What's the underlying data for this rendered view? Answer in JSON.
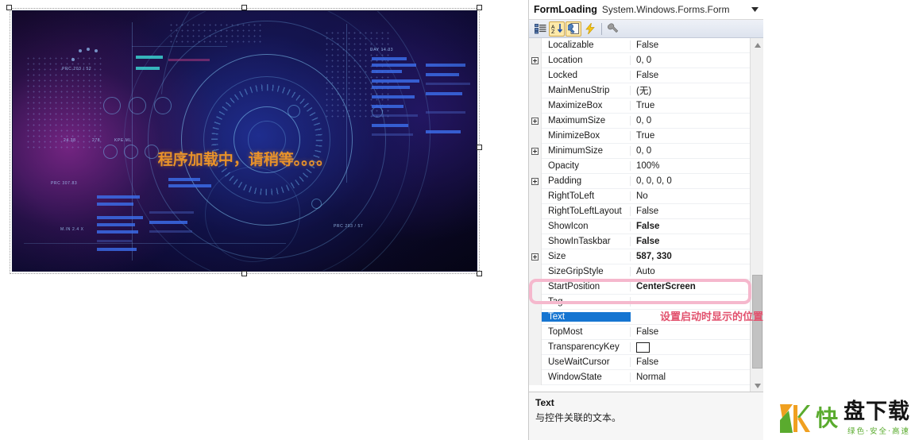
{
  "designer": {
    "form_name": "FormLoading",
    "loading_text": "程序加载中，请稍等。。。。",
    "hud_labels": [
      "PRC 203 / 52",
      "DAY 14.33",
      "24.38",
      "278",
      "KPE.ML",
      "PRC 307.83",
      "PRC 203 / 57",
      "M.IN 2.4 X"
    ]
  },
  "properties_panel": {
    "object_name": "FormLoading",
    "object_type": "System.Windows.Forms.Form",
    "toolbar": {
      "categorized_label": "Categorized",
      "alphabetical_label": "Alphabetical",
      "properties_label": "Properties",
      "events_label": "Events",
      "property_pages_label": "Property Pages"
    },
    "rows": [
      {
        "name": "Localizable",
        "value": "False",
        "expandable": false,
        "bold": false,
        "selected": false
      },
      {
        "name": "Location",
        "value": "0, 0",
        "expandable": true,
        "bold": false,
        "selected": false
      },
      {
        "name": "Locked",
        "value": "False",
        "expandable": false,
        "bold": false,
        "selected": false
      },
      {
        "name": "MainMenuStrip",
        "value": "(无)",
        "expandable": false,
        "bold": false,
        "selected": false
      },
      {
        "name": "MaximizeBox",
        "value": "True",
        "expandable": false,
        "bold": false,
        "selected": false
      },
      {
        "name": "MaximumSize",
        "value": "0, 0",
        "expandable": true,
        "bold": false,
        "selected": false
      },
      {
        "name": "MinimizeBox",
        "value": "True",
        "expandable": false,
        "bold": false,
        "selected": false
      },
      {
        "name": "MinimumSize",
        "value": "0, 0",
        "expandable": true,
        "bold": false,
        "selected": false
      },
      {
        "name": "Opacity",
        "value": "100%",
        "expandable": false,
        "bold": false,
        "selected": false
      },
      {
        "name": "Padding",
        "value": "0, 0, 0, 0",
        "expandable": true,
        "bold": false,
        "selected": false
      },
      {
        "name": "RightToLeft",
        "value": "No",
        "expandable": false,
        "bold": false,
        "selected": false
      },
      {
        "name": "RightToLeftLayout",
        "value": "False",
        "expandable": false,
        "bold": false,
        "selected": false
      },
      {
        "name": "ShowIcon",
        "value": "False",
        "expandable": false,
        "bold": true,
        "selected": false
      },
      {
        "name": "ShowInTaskbar",
        "value": "False",
        "expandable": false,
        "bold": true,
        "selected": false
      },
      {
        "name": "Size",
        "value": "587, 330",
        "expandable": true,
        "bold": true,
        "selected": false
      },
      {
        "name": "SizeGripStyle",
        "value": "Auto",
        "expandable": false,
        "bold": false,
        "selected": false
      },
      {
        "name": "StartPosition",
        "value": "CenterScreen",
        "expandable": false,
        "bold": true,
        "selected": false
      },
      {
        "name": "Tag",
        "value": "",
        "expandable": false,
        "bold": false,
        "selected": false
      },
      {
        "name": "Text",
        "value": "",
        "expandable": false,
        "bold": false,
        "selected": true
      },
      {
        "name": "TopMost",
        "value": "False",
        "expandable": false,
        "bold": false,
        "selected": false
      },
      {
        "name": "TransparencyKey",
        "value": "",
        "expandable": false,
        "bold": false,
        "selected": false,
        "swatch": "#ffffff"
      },
      {
        "name": "UseWaitCursor",
        "value": "False",
        "expandable": false,
        "bold": false,
        "selected": false
      },
      {
        "name": "WindowState",
        "value": "Normal",
        "expandable": false,
        "bold": false,
        "selected": false
      }
    ],
    "description": {
      "title": "Text",
      "body": "与控件关联的文本。"
    }
  },
  "annotation": {
    "text": "设置启动时显示的位置",
    "color": "#e2516d",
    "highlight_color": "#f5b8cd"
  },
  "watermark": {
    "kuai": "快",
    "main": "盘下载",
    "tagline": "绿色·安全·高速"
  }
}
